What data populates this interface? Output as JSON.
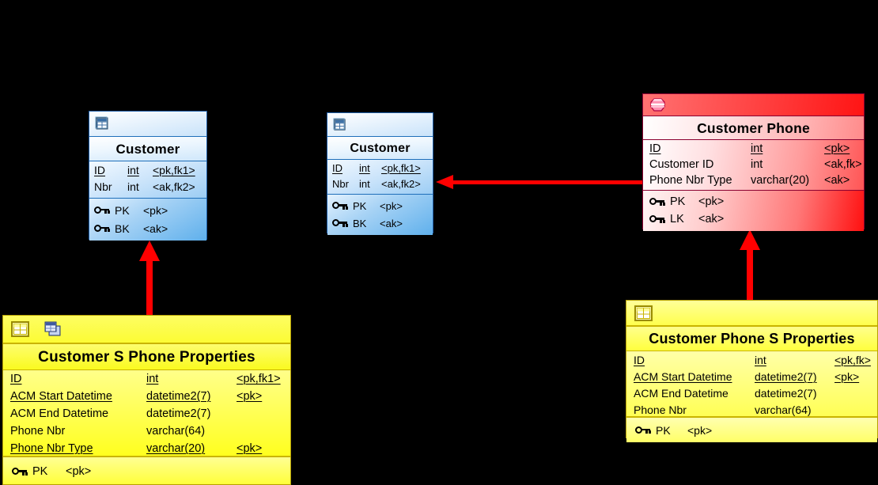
{
  "diagram": {
    "title": "Entity Relationship Diagram",
    "background_color": "#000000",
    "connector_color": "#ff0000"
  },
  "entities": [
    {
      "id": "customer-left",
      "name": "Customer",
      "style": "blue",
      "icons": [
        "table-icon"
      ],
      "attributes": [
        {
          "name": "ID",
          "type": "int",
          "flag": "<pk,fk1>",
          "underlined": true
        },
        {
          "name": "Nbr",
          "type": "int",
          "flag": "<ak,fk2>",
          "underlined": false
        }
      ],
      "keys": [
        {
          "icon": "key-icon",
          "label": "PK",
          "flag": "<pk>"
        },
        {
          "icon": "key-icon",
          "label": "BK",
          "flag": "<ak>"
        }
      ]
    },
    {
      "id": "customer-mid",
      "name": "Customer",
      "style": "blue",
      "icons": [
        "table-icon"
      ],
      "attributes": [
        {
          "name": "ID",
          "type": "int",
          "flag": "<pk,fk1>",
          "underlined": true
        },
        {
          "name": "Nbr",
          "type": "int",
          "flag": "<ak,fk2>",
          "underlined": false
        }
      ],
      "keys": [
        {
          "icon": "key-icon",
          "label": "PK",
          "flag": "<pk>"
        },
        {
          "icon": "key-icon",
          "label": "BK",
          "flag": "<ak>"
        }
      ]
    },
    {
      "id": "customer-phone",
      "name": "Customer Phone",
      "style": "red",
      "icons": [
        "view-icon"
      ],
      "attributes": [
        {
          "name": "ID",
          "type": "int",
          "flag": "<pk>",
          "underlined": true
        },
        {
          "name": "Customer ID",
          "type": "int",
          "flag": "<ak,fk>",
          "underlined": false
        },
        {
          "name": "Phone Nbr Type",
          "type": "varchar(20)",
          "flag": "<ak>",
          "underlined": false
        }
      ],
      "keys": [
        {
          "icon": "key-icon",
          "label": "PK",
          "flag": "<pk>"
        },
        {
          "icon": "key-icon",
          "label": "LK",
          "flag": "<ak>"
        }
      ]
    },
    {
      "id": "customer-s-phone-properties",
      "name": "Customer S Phone Properties",
      "style": "yellow",
      "icons": [
        "table-icon",
        "copies-icon"
      ],
      "attributes": [
        {
          "name": "ID",
          "type": "int",
          "flag": "<pk,fk1>",
          "underlined": true
        },
        {
          "name": "ACM Start Datetime",
          "type": "datetime2(7)",
          "flag": "<pk>",
          "underlined": true
        },
        {
          "name": "ACM End Datetime",
          "type": "datetime2(7)",
          "flag": "",
          "underlined": false
        },
        {
          "name": "Phone Nbr",
          "type": "varchar(64)",
          "flag": "",
          "underlined": false
        },
        {
          "name": "Phone Nbr Type",
          "type": "varchar(20)",
          "flag": "<pk>",
          "underlined": true
        }
      ],
      "keys": [
        {
          "icon": "key-icon",
          "label": "PK",
          "flag": "<pk>"
        }
      ]
    },
    {
      "id": "customer-phone-s-properties",
      "name": "Customer Phone S Properties",
      "style": "yellow",
      "icons": [
        "table-icon"
      ],
      "attributes": [
        {
          "name": "ID",
          "type": "int",
          "flag": "<pk,fk>",
          "underlined": true
        },
        {
          "name": "ACM Start Datetime",
          "type": "datetime2(7)",
          "flag": "<pk>",
          "underlined": true
        },
        {
          "name": "ACM End Datetime",
          "type": "datetime2(7)",
          "flag": "",
          "underlined": false
        },
        {
          "name": "Phone Nbr",
          "type": "varchar(64)",
          "flag": "",
          "underlined": false
        }
      ],
      "keys": [
        {
          "icon": "key-icon",
          "label": "PK",
          "flag": "<pk>"
        }
      ]
    }
  ],
  "connectors": [
    {
      "id": "conn-left",
      "from": "customer-s-phone-properties",
      "to": "customer-left",
      "direction": "up",
      "thickness": "thick"
    },
    {
      "id": "conn-horizontal",
      "from": "customer-phone",
      "to": "customer-mid",
      "direction": "left",
      "thickness": "thin"
    },
    {
      "id": "conn-right",
      "from": "customer-phone-s-properties",
      "to": "customer-phone",
      "direction": "up",
      "thickness": "thick"
    }
  ]
}
